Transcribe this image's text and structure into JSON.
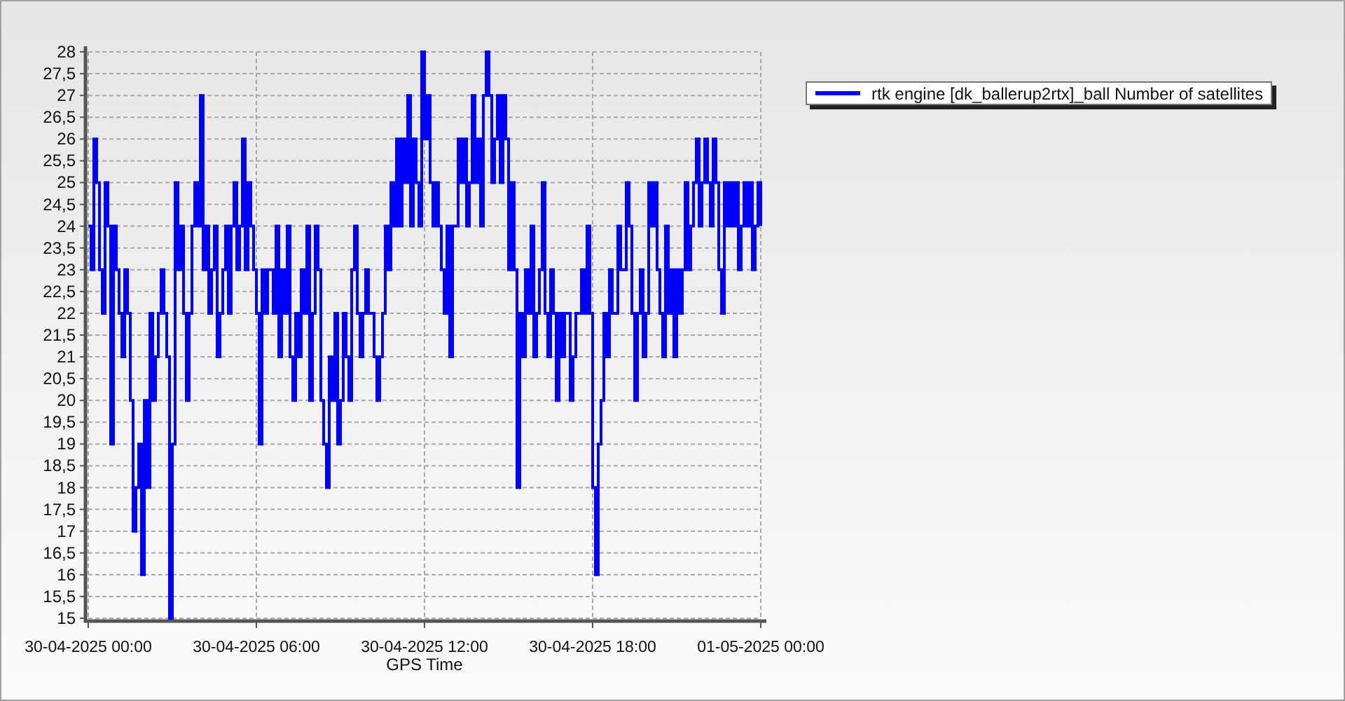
{
  "chart_data": {
    "type": "line",
    "xlabel": "GPS Time",
    "grid": true,
    "ylim": [
      15,
      28
    ],
    "categories": [
      "30-04-2025 00:00",
      null,
      null,
      null,
      null,
      null,
      null,
      null,
      null,
      null,
      null,
      null,
      null,
      null,
      null,
      null,
      null,
      null,
      null,
      null,
      null,
      null,
      null,
      null,
      null,
      null,
      null,
      null,
      null,
      null,
      null,
      null,
      null,
      null,
      null,
      null,
      null,
      null,
      null,
      null,
      null,
      null,
      null,
      null,
      null,
      null,
      null,
      null,
      null,
      null,
      null,
      null,
      null,
      null,
      null,
      null,
      null,
      null,
      null,
      null,
      "30-04-2025 06:00",
      null,
      null,
      null,
      null,
      null,
      null,
      null,
      null,
      null,
      null,
      null,
      null,
      null,
      null,
      null,
      null,
      null,
      null,
      null,
      null,
      null,
      null,
      null,
      null,
      null,
      null,
      null,
      null,
      null,
      null,
      null,
      null,
      null,
      null,
      null,
      null,
      null,
      null,
      null,
      null,
      null,
      null,
      null,
      null,
      null,
      null,
      null,
      null,
      null,
      null,
      null,
      null,
      null,
      null,
      null,
      null,
      null,
      null,
      null,
      "30-04-2025 12:00",
      null,
      null,
      null,
      null,
      null,
      null,
      null,
      null,
      null,
      null,
      null,
      null,
      null,
      null,
      null,
      null,
      null,
      null,
      null,
      null,
      null,
      null,
      null,
      null,
      null,
      null,
      null,
      null,
      null,
      null,
      null,
      null,
      null,
      null,
      null,
      null,
      null,
      null,
      null,
      null,
      null,
      null,
      null,
      null,
      null,
      null,
      null,
      null,
      null,
      null,
      null,
      null,
      null,
      null,
      null,
      null,
      null,
      null,
      null,
      "30-04-2025 18:00",
      null,
      null,
      null,
      null,
      null,
      null,
      null,
      null,
      null,
      null,
      null,
      null,
      null,
      null,
      null,
      null,
      null,
      null,
      null,
      null,
      null,
      null,
      null,
      null,
      null,
      null,
      null,
      null,
      null,
      null,
      null,
      null,
      null,
      null,
      null,
      null,
      null,
      null,
      null,
      null,
      null,
      null,
      null,
      null,
      null,
      null,
      null,
      null,
      null,
      null,
      null,
      null,
      null,
      null,
      null,
      null,
      null,
      null,
      null,
      "01-05-2025 00:00"
    ],
    "yticks": [
      {
        "value": 15,
        "label": "15"
      },
      {
        "value": 15.5,
        "label": "15,5"
      },
      {
        "value": 16,
        "label": "16"
      },
      {
        "value": 16.5,
        "label": "16,5"
      },
      {
        "value": 17,
        "label": "17"
      },
      {
        "value": 17.5,
        "label": "17,5"
      },
      {
        "value": 18,
        "label": "18"
      },
      {
        "value": 18.5,
        "label": "18,5"
      },
      {
        "value": 19,
        "label": "19"
      },
      {
        "value": 19.5,
        "label": "19,5"
      },
      {
        "value": 20,
        "label": "20"
      },
      {
        "value": 20.5,
        "label": "20,5"
      },
      {
        "value": 21,
        "label": "21"
      },
      {
        "value": 21.5,
        "label": "21,5"
      },
      {
        "value": 22,
        "label": "22"
      },
      {
        "value": 22.5,
        "label": "22,5"
      },
      {
        "value": 23,
        "label": "23"
      },
      {
        "value": 23.5,
        "label": "23,5"
      },
      {
        "value": 24,
        "label": "24"
      },
      {
        "value": 24.5,
        "label": "24,5"
      },
      {
        "value": 25,
        "label": "25"
      },
      {
        "value": 25.5,
        "label": "25,5"
      },
      {
        "value": 26,
        "label": "26"
      },
      {
        "value": 26.5,
        "label": "26,5"
      },
      {
        "value": 27,
        "label": "27"
      },
      {
        "value": 27.5,
        "label": "27,5"
      },
      {
        "value": 28,
        "label": "28"
      }
    ],
    "series": [
      {
        "name": "rtk engine [dk_ballerup2rtx]_ball Number of satellites",
        "color": "#0000ff",
        "values": [
          24,
          23,
          26,
          25,
          23,
          22,
          25,
          24,
          19,
          24,
          23,
          22,
          21,
          23,
          22,
          20,
          17,
          18,
          19,
          16,
          20,
          18,
          22,
          20,
          21,
          22,
          23,
          22,
          21,
          15,
          19,
          25,
          23,
          24,
          22,
          20,
          22,
          24,
          25,
          24,
          27,
          23,
          24,
          22,
          23,
          24,
          21,
          22,
          23,
          24,
          22,
          24,
          25,
          23,
          24,
          26,
          23,
          25,
          24,
          23,
          22,
          19,
          23,
          22,
          23,
          23,
          22,
          24,
          21,
          23,
          22,
          24,
          21,
          20,
          22,
          21,
          23,
          22,
          24,
          20,
          22,
          24,
          23,
          20,
          19,
          18,
          21,
          20,
          22,
          19,
          20,
          22,
          21,
          20,
          23,
          24,
          22,
          21,
          22,
          23,
          22,
          22,
          21,
          20,
          21,
          22,
          24,
          23,
          25,
          24,
          26,
          24,
          26,
          25,
          27,
          24,
          26,
          25,
          24,
          28,
          26,
          27,
          25,
          24,
          25,
          24,
          23,
          22,
          24,
          21,
          24,
          24,
          26,
          25,
          26,
          24,
          25,
          27,
          25,
          26,
          24,
          27,
          28,
          27,
          25,
          26,
          27,
          25,
          27,
          26,
          23,
          25,
          23,
          18,
          22,
          21,
          23,
          22,
          24,
          21,
          22,
          23,
          25,
          22,
          21,
          23,
          22,
          20,
          22,
          21,
          22,
          22,
          20,
          21,
          22,
          22,
          23,
          22,
          24,
          22,
          18,
          16,
          19,
          20,
          22,
          21,
          23,
          22,
          22,
          24,
          23,
          23,
          25,
          24,
          22,
          20,
          22,
          23,
          21,
          22,
          25,
          24,
          25,
          23,
          22,
          21,
          24,
          22,
          23,
          21,
          23,
          22,
          23,
          25,
          23,
          24,
          25,
          26,
          24,
          25,
          26,
          25,
          24,
          26,
          25,
          23,
          22,
          25,
          24,
          25,
          24,
          25,
          23,
          24,
          25,
          24,
          25,
          23,
          24,
          25,
          24
        ]
      }
    ]
  }
}
